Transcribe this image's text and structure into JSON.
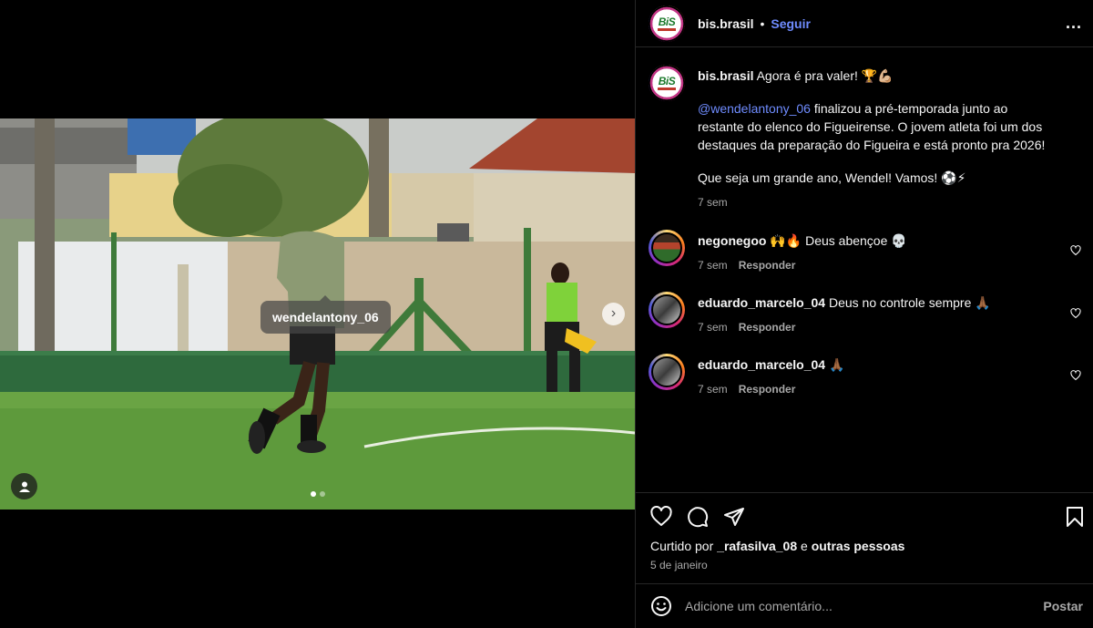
{
  "post": {
    "author": "bis.brasil",
    "follow_label": "Seguir",
    "separator": "•",
    "more_label": "...",
    "logo_text": "BiS"
  },
  "media": {
    "tagged_user": "wendelantony_06",
    "next_label": "›",
    "slide_count": 2,
    "current_slide": 1
  },
  "caption": {
    "author": "bis.brasil",
    "line1": "Agora é pra valer! 🏆💪🏼",
    "mention": "@wendelantony_06",
    "paragraph_rest": " finalizou a pré-temporada junto ao restante do elenco do Figueirense. O jovem atleta foi um dos destaques da preparação do Figueira e está pronto pra 2026!",
    "closing": "Que seja um grande ano, Wendel! Vamos! ⚽⚡",
    "time": "7 sem"
  },
  "comments": [
    {
      "user": "negonegoo",
      "text": "🙌🔥 Deus abençoe 💀",
      "time": "7 sem",
      "reply": "Responder"
    },
    {
      "user": "eduardo_marcelo_04",
      "text": "Deus no controle sempre 🙏🏾",
      "time": "7 sem",
      "reply": "Responder"
    },
    {
      "user": "eduardo_marcelo_04",
      "text": "🙏🏾",
      "time": "7 sem",
      "reply": "Responder"
    }
  ],
  "likes": {
    "prefix": "Curtido por",
    "user": "_rafasilva_08",
    "connector": "e",
    "others": "outras pessoas"
  },
  "date": "5 de janeiro",
  "add_comment": {
    "placeholder": "Adicione um comentário...",
    "post_label": "Postar"
  },
  "colors": {
    "link": "#6f8cff",
    "muted": "#a8a8a8",
    "divider": "#262626"
  }
}
